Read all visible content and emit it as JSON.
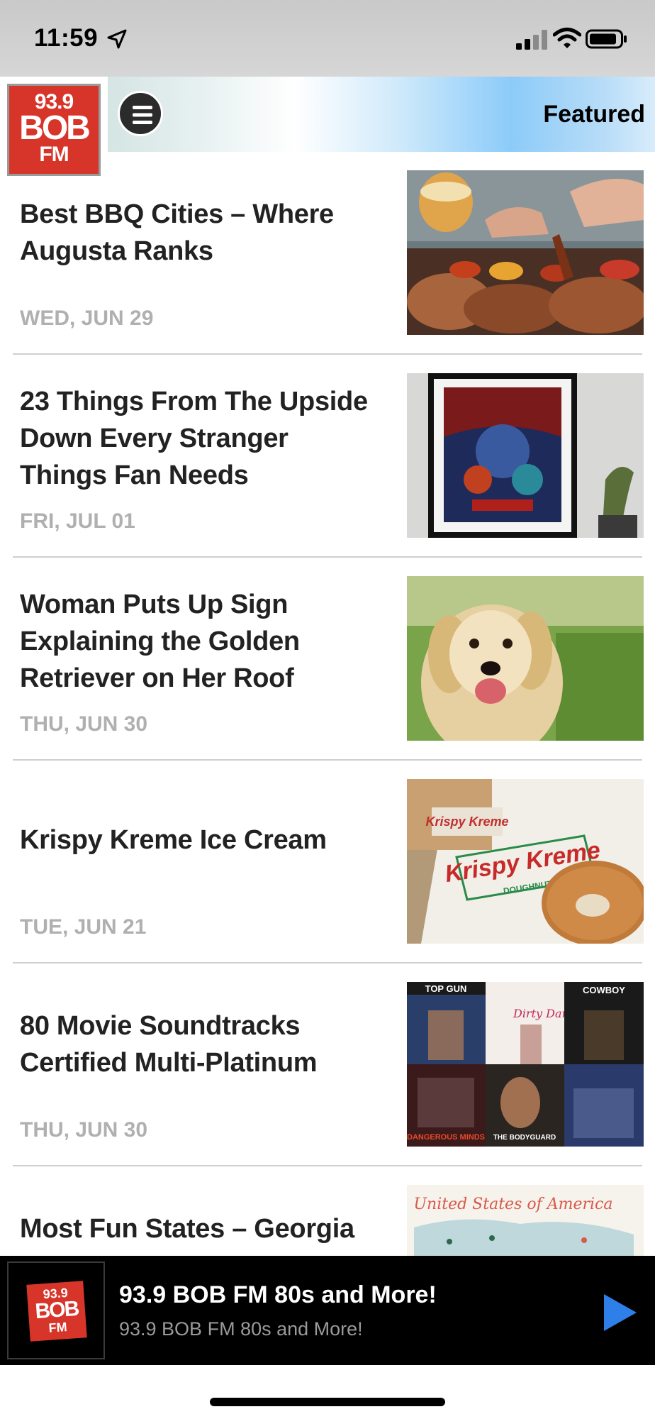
{
  "status_bar": {
    "time": "11:59"
  },
  "header": {
    "logo": {
      "line1": "93.9",
      "line2": "BOB",
      "line3": "FM"
    },
    "title": "Featured"
  },
  "articles": [
    {
      "title": "Best BBQ Cities – Where Augusta Ranks",
      "date": "WED, JUN 29",
      "thumb": "bbq-platter"
    },
    {
      "title": "23 Things From The Upside Down Every Stranger Things Fan Needs",
      "date": "FRI, JUL 01",
      "thumb": "stranger-things-poster"
    },
    {
      "title": "Woman Puts Up Sign Explaining the Golden Retriever on Her Roof",
      "date": "THU, JUN 30",
      "thumb": "golden-retriever"
    },
    {
      "title": "Krispy Kreme Ice Cream",
      "date": "TUE, JUN 21",
      "thumb": "krispy-kreme-donut"
    },
    {
      "title": "80 Movie Soundtracks Certified Multi-Platinum",
      "date": "THU, JUN 30",
      "thumb": "soundtrack-covers"
    },
    {
      "title": "Most Fun States – Georgia",
      "date": "",
      "thumb": "united-states-map"
    }
  ],
  "thumb_text": {
    "topgun": "TOP GUN",
    "dirty": "Dirty Dancing",
    "cowboy": "COWBOY",
    "dangerous": "DANGEROUS MINDS",
    "bodyguard": "THE BODYGUARD",
    "kk1": "Krispy Kreme",
    "kk2": "DOUGHNUTS",
    "map": "United States of America"
  },
  "player": {
    "logo": {
      "line1": "93.9",
      "line2": "BOB",
      "line3": "FM"
    },
    "title": "93.9 BOB FM 80s and More!",
    "subtitle": "93.9 BOB FM 80s and More!"
  },
  "colors": {
    "brand_red": "#d8352a",
    "play_blue": "#2f7fe8",
    "date_gray": "#b0b0b0"
  }
}
